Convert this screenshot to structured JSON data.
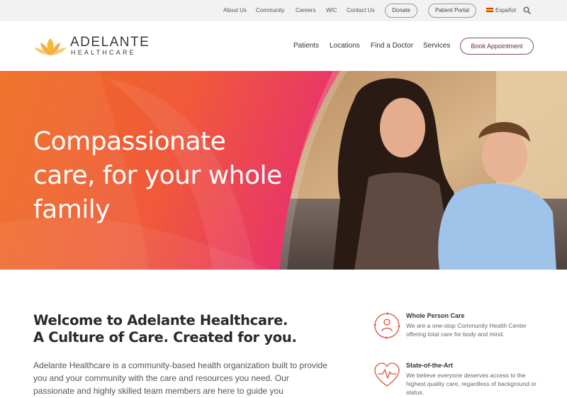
{
  "utility": {
    "links": [
      "About Us",
      "Community",
      "Careers",
      "WIC",
      "Contact Us"
    ],
    "donate_label": "Donate",
    "portal_label": "Patient Portal",
    "language_label": "Español"
  },
  "header": {
    "logo_name": "ADELANTE",
    "logo_sub": "HEALTHCARE",
    "nav": [
      "Patients",
      "Locations",
      "Find a Doctor",
      "Services"
    ],
    "book_label": "Book Appointment"
  },
  "hero": {
    "title": "Compassionate care, for your whole family"
  },
  "welcome": {
    "title_line1": "Welcome to Adelante Healthcare.",
    "title_line2": "A Culture of Care. Created for you.",
    "body": "Adelante Healthcare is a community-based health organization built to provide you and your community with the care and resources you need. Our passionate and highly skilled team members are here to guide you"
  },
  "features": [
    {
      "title": "Whole Person Care",
      "text": "We are a one-stop Community Health Center offering total care for body and mind.",
      "icon": "person-cycle-icon"
    },
    {
      "title": "State-of-the-Art",
      "text": "We believe everyone deserves access to the highest quality care, regardless of background or status.",
      "icon": "heartbeat-icon"
    }
  ],
  "colors": {
    "accent_orange": "#ef6c1f",
    "accent_pink": "#e5336d",
    "icon_red": "#e0503a",
    "button_border": "#8a4a60"
  }
}
